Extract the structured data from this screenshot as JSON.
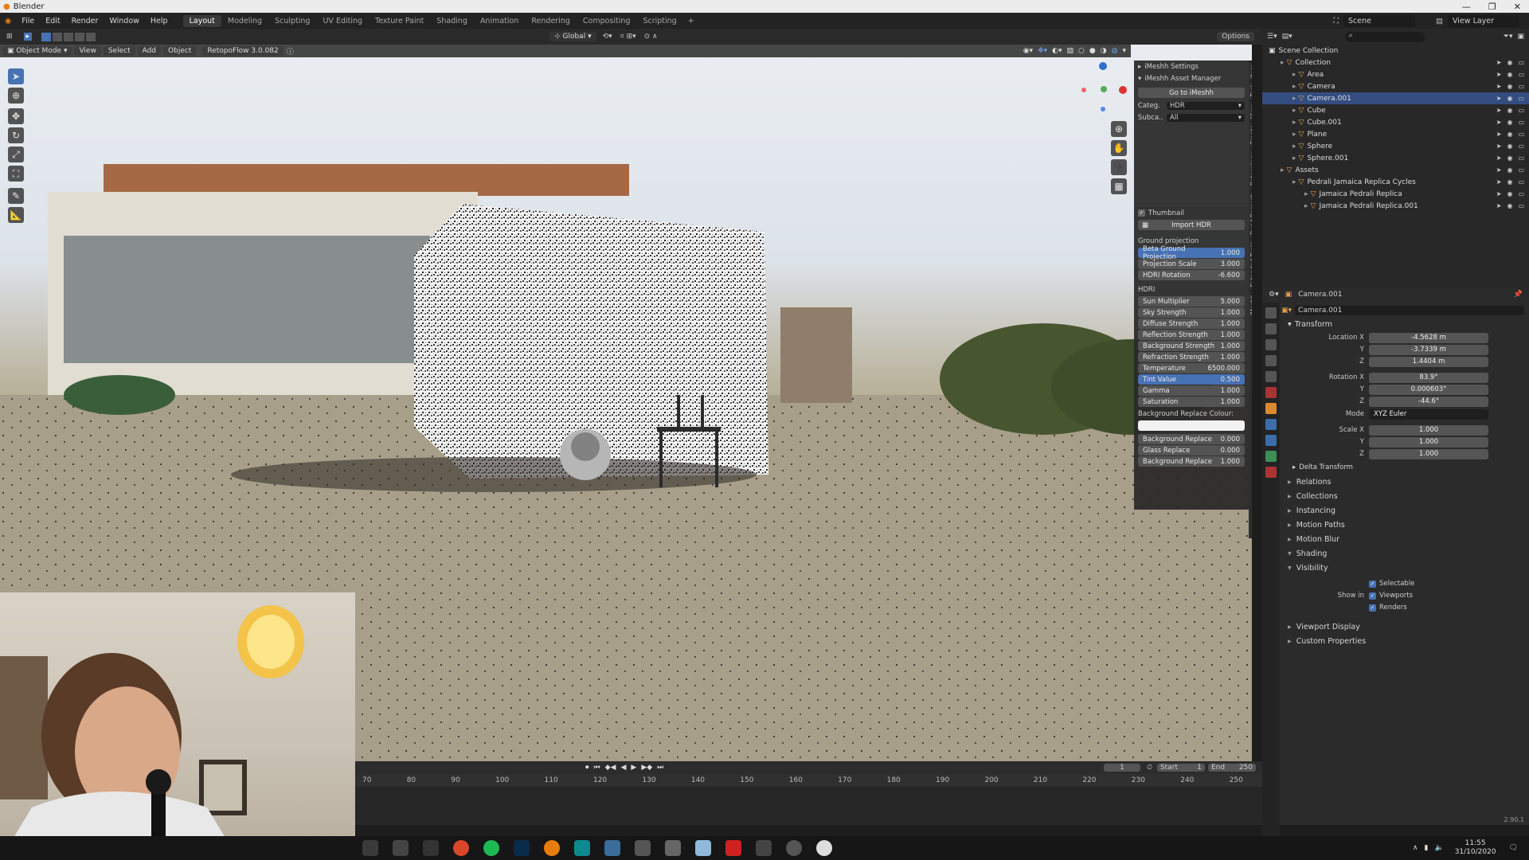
{
  "app": {
    "title": "Blender"
  },
  "menu": [
    "File",
    "Edit",
    "Render",
    "Window",
    "Help"
  ],
  "workspaces": [
    "Layout",
    "Modeling",
    "Sculpting",
    "UV Editing",
    "Texture Paint",
    "Shading",
    "Animation",
    "Rendering",
    "Compositing",
    "Scripting"
  ],
  "active_workspace": "Layout",
  "toolbar": {
    "transform": "Global",
    "options": "Options",
    "scene_label": "Scene",
    "view_layer": "View Layer"
  },
  "viewport_header": {
    "mode": "Object Mode",
    "view": "View",
    "select": "Select",
    "add": "Add",
    "object": "Object",
    "addon": "RetopoFlow 3.0.082"
  },
  "imeshh": {
    "settings": "iMeshh Settings",
    "asset_manager": "iMeshh Asset Manager",
    "go_to": "Go to iMeshh",
    "category_label": "Categ.",
    "category_value": "HDR",
    "subcategory_label": "Subca..",
    "subcategory_value": "All",
    "thumbnail_label": "Thumbnail",
    "import_button": "Import HDR",
    "ground_projection_label": "Ground projection",
    "ground_fields": [
      {
        "label": "Beta Ground Projection",
        "value": "1.000",
        "on": true
      },
      {
        "label": "Projection Scale",
        "value": "3.000",
        "on": false
      },
      {
        "label": "HDRI Rotation",
        "value": "-6.600",
        "on": false
      }
    ],
    "hdri_label": "HDRI",
    "hdri_fields": [
      {
        "label": "Sun Multiplier",
        "value": "5.000",
        "on": false
      },
      {
        "label": "Sky Strength",
        "value": "1.000",
        "on": false
      },
      {
        "label": "Diffuse Strength",
        "value": "1.000",
        "on": false
      },
      {
        "label": "Reflection Strength",
        "value": "1.000",
        "on": false
      },
      {
        "label": "Background Strength",
        "value": "1.000",
        "on": false
      },
      {
        "label": "Refraction Strength",
        "value": "1.000",
        "on": false
      },
      {
        "label": "Temperature",
        "value": "6500.000",
        "on": false
      },
      {
        "label": "Tint Value",
        "value": "0.500",
        "on": true
      },
      {
        "label": "Gamma",
        "value": "1.000",
        "on": false
      },
      {
        "label": "Saturation",
        "value": "1.000",
        "on": false
      }
    ],
    "bg_colour_label": "Background Replace Colour:",
    "bg_fields": [
      {
        "label": "Background Replace",
        "value": "0.000",
        "on": false
      },
      {
        "label": "Glass Replace",
        "value": "0.000",
        "on": false
      },
      {
        "label": "Background Replace",
        "value": "1.000",
        "on": false
      }
    ]
  },
  "side_tabs": [
    "Item",
    "Tool",
    "View",
    "Create",
    "Retopology",
    "Quad Remesh",
    "Extended Tools",
    "iMeshh"
  ],
  "outliner": {
    "root": "Scene Collection",
    "rows": [
      {
        "label": "Collection",
        "indent": 1,
        "sel": false
      },
      {
        "label": "Area",
        "indent": 2,
        "sel": false
      },
      {
        "label": "Camera",
        "indent": 2,
        "sel": false
      },
      {
        "label": "Camera.001",
        "indent": 2,
        "sel": true
      },
      {
        "label": "Cube",
        "indent": 2,
        "sel": false
      },
      {
        "label": "Cube.001",
        "indent": 2,
        "sel": false
      },
      {
        "label": "Plane",
        "indent": 2,
        "sel": false
      },
      {
        "label": "Sphere",
        "indent": 2,
        "sel": false
      },
      {
        "label": "Sphere.001",
        "indent": 2,
        "sel": false
      },
      {
        "label": "Assets",
        "indent": 1,
        "sel": false
      },
      {
        "label": "Pedrali Jamaica Replica Cycles",
        "indent": 2,
        "sel": false
      },
      {
        "label": "Jamaica Pedrali Replica",
        "indent": 3,
        "sel": false
      },
      {
        "label": "Jamaica Pedrali Replica.001",
        "indent": 3,
        "sel": false
      }
    ]
  },
  "properties": {
    "object_name": "Camera.001",
    "transform": "Transform",
    "location_label": "Location X",
    "location": [
      "-4.5628 m",
      "-3.7339 m",
      "1.4404 m"
    ],
    "rotation_label": "Rotation X",
    "rotation": [
      "83.9°",
      "0.000603°",
      "-44.6°"
    ],
    "mode_label": "Mode",
    "mode_value": "XYZ Euler",
    "scale_label": "Scale X",
    "scale": [
      "1.000",
      "1.000",
      "1.000"
    ],
    "axis_y": "Y",
    "axis_z": "Z",
    "delta": "Delta Transform",
    "sections": [
      "Relations",
      "Collections",
      "Instancing",
      "Motion Paths",
      "Motion Blur",
      "Shading",
      "Visibility"
    ],
    "selectable": "Selectable",
    "show_in": "Show in",
    "viewports": "Viewports",
    "renders": "Renders",
    "sections2": [
      "Viewport Display",
      "Custom Properties"
    ]
  },
  "timeline": {
    "current": "1",
    "start_label": "Start",
    "start": "1",
    "end_label": "End",
    "end": "250",
    "ticks": [
      "70",
      "80",
      "90",
      "100",
      "110",
      "120",
      "130",
      "140",
      "150",
      "160",
      "170",
      "180",
      "190",
      "200",
      "210",
      "220",
      "230",
      "240",
      "250"
    ]
  },
  "status": {
    "version": "2.90.1"
  },
  "taskbar": {
    "time": "11:55",
    "date": "31/10/2020"
  }
}
